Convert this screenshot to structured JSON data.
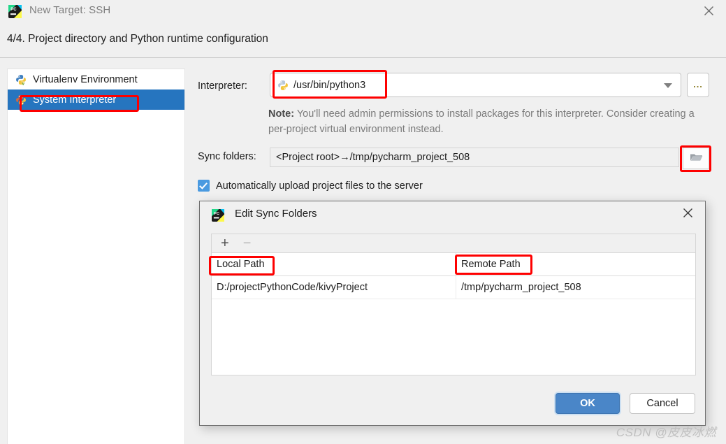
{
  "window": {
    "title": "New Target: SSH",
    "app_icon": "pycharm-icon",
    "close_icon": "close-icon",
    "step_title": "4/4. Project directory and Python runtime configuration"
  },
  "sidebar": {
    "items": [
      {
        "label": "Virtualenv Environment",
        "icon": "python-virtualenv-icon",
        "selected": false
      },
      {
        "label": "System Interpreter",
        "icon": "python-icon",
        "selected": true
      }
    ]
  },
  "form": {
    "interpreter_label": "Interpreter:",
    "interpreter_value": "/usr/bin/python3",
    "interpreter_value_icon": "python-icon",
    "interpreter_dropdown_icon": "chevron-down-icon",
    "interpreter_browse_label": "...",
    "note_prefix": "Note:",
    "note_text": " You'll need admin permissions to install packages for this interpreter. Consider creating a per-project virtual environment instead.",
    "sync_folders_label": "Sync folders:",
    "sync_folders_value": "<Project root>→/tmp/pycharm_project_508",
    "sync_folders_browse_icon": "folder-icon",
    "autoupload_label": "Automatically upload project files to the server",
    "autoupload_checked": true
  },
  "dialog": {
    "title": "Edit Sync Folders",
    "app_icon": "pycharm-icon",
    "close_icon": "close-icon",
    "toolbar": {
      "add_label": "+",
      "remove_label": "−"
    },
    "table": {
      "columns": [
        "Local Path",
        "Remote Path"
      ],
      "rows": [
        [
          "D:/projectPythonCode/kivyProject",
          "/tmp/pycharm_project_508"
        ]
      ]
    },
    "ok_label": "OK",
    "cancel_label": "Cancel"
  },
  "annotations": {
    "color": "#fe0000",
    "boxes": [
      "system-interpreter",
      "interpreter-value",
      "sync-folders-browse-button",
      "local-path-column-header",
      "remote-path-column-header"
    ]
  },
  "watermark": {
    "text": "CSDN @皮皮冰燃"
  }
}
